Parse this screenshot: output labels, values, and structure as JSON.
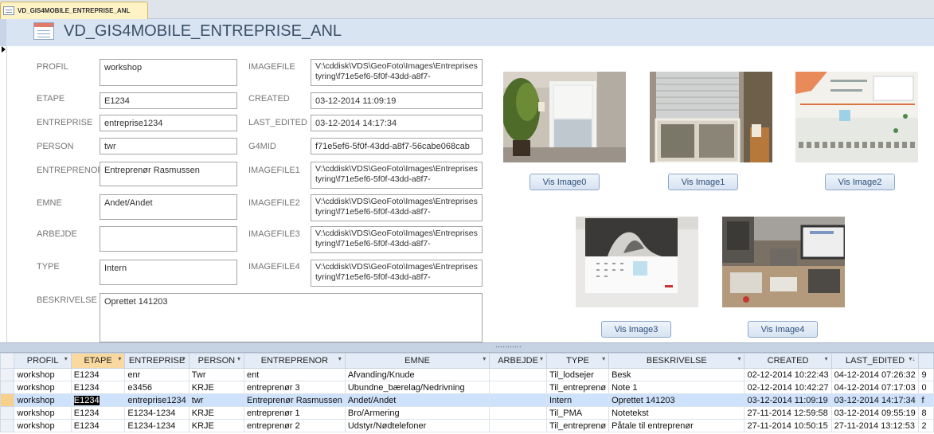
{
  "tab": {
    "label": "VD_GIS4MOBILE_ENTREPRISE_ANL"
  },
  "form": {
    "title": "VD_GIS4MOBILE_ENTREPRISE_ANL",
    "fields": {
      "profil": {
        "label": "PROFIL",
        "value": "workshop"
      },
      "etape": {
        "label": "ETAPE",
        "value": "E1234"
      },
      "entreprise": {
        "label": "ENTREPRISE",
        "value": "entreprise1234"
      },
      "person": {
        "label": "PERSON",
        "value": "twr"
      },
      "entreprenor": {
        "label": "ENTREPRENOR",
        "value": "Entreprenør Rasmussen"
      },
      "emne": {
        "label": "EMNE",
        "value": "Andet/Andet"
      },
      "arbejde": {
        "label": "ARBEJDE",
        "value": ""
      },
      "type": {
        "label": "TYPE",
        "value": "Intern"
      },
      "beskrivelse": {
        "label": "BESKRIVELSE",
        "value": "Oprettet 141203"
      },
      "imagefile": {
        "label": "IMAGEFILE",
        "value": "V:\\cddisk\\VDS\\GeoFoto\\Images\\Entreprisestyring\\f71e5ef6-5f0f-43dd-a8f7-"
      },
      "created": {
        "label": "CREATED",
        "value": "03-12-2014 11:09:19"
      },
      "last_edited": {
        "label": "LAST_EDITED",
        "value": "03-12-2014 14:17:34"
      },
      "g4mid": {
        "label": "G4MID",
        "value": "f71e5ef6-5f0f-43dd-a8f7-56cabe068cab"
      },
      "imagefile1": {
        "label": "IMAGEFILE1",
        "value": "V:\\cddisk\\VDS\\GeoFoto\\Images\\Entreprisestyring\\f71e5ef6-5f0f-43dd-a8f7-"
      },
      "imagefile2": {
        "label": "IMAGEFILE2",
        "value": "V:\\cddisk\\VDS\\GeoFoto\\Images\\Entreprisestyring\\f71e5ef6-5f0f-43dd-a8f7-"
      },
      "imagefile3": {
        "label": "IMAGEFILE3",
        "value": "V:\\cddisk\\VDS\\GeoFoto\\Images\\Entreprisestyring\\f71e5ef6-5f0f-43dd-a8f7-"
      },
      "imagefile4": {
        "label": "IMAGEFILE4",
        "value": "V:\\cddisk\\VDS\\GeoFoto\\Images\\Entreprisestyring\\f71e5ef6-5f0f-43dd-a8f7-"
      }
    },
    "buttons": {
      "vis_image0": "Vis Image0",
      "vis_image1": "Vis Image1",
      "vis_image2": "Vis Image2",
      "vis_image3": "Vis Image3",
      "vis_image4": "Vis Image4"
    }
  },
  "datasheet": {
    "columns": [
      "PROFIL",
      "ETAPE",
      "ENTREPRISE",
      "PERSON",
      "ENTREPRENOR",
      "EMNE",
      "ARBEJDE",
      "TYPE",
      "BESKRIVELSE",
      "CREATED",
      "LAST_EDITED"
    ],
    "rows": [
      [
        "workshop",
        "E1234",
        "enr",
        "Twr",
        "ent",
        "Afvanding/Knude",
        "",
        "Til_lodsejer",
        "Besk",
        "02-12-2014 10:22:43",
        "04-12-2014 07:26:32"
      ],
      [
        "workshop",
        "E1234",
        "e3456",
        "KRJE",
        "entreprenør 3",
        "Ubundne_bærelag/Nedrivning",
        "",
        "Til_entreprenø",
        "Note 1",
        "02-12-2014 10:42:27",
        "04-12-2014 07:17:03"
      ],
      [
        "workshop",
        "E1234",
        "entreprise1234",
        "twr",
        "Entreprenør Rasmussen",
        "Andet/Andet",
        "",
        "Intern",
        "Oprettet 141203",
        "03-12-2014 11:09:19",
        "03-12-2014 14:17:34"
      ],
      [
        "workshop",
        "E1234",
        "E1234-1234",
        "KRJE",
        "entreprenør 1",
        "Bro/Armering",
        "",
        "Til_PMA",
        "Notetekst",
        "27-11-2014 12:59:58",
        "03-12-2014 09:55:19"
      ],
      [
        "workshop",
        "E1234",
        "E1234-1234",
        "KRJE",
        "entreprenør 2",
        "Udstyr/Nødtelefoner",
        "",
        "Til_entreprenø",
        "Påtale til entreprenør",
        "27-11-2014 10:50:15",
        "27-11-2014 13:12:53"
      ]
    ],
    "overflow_col": [
      "9",
      "0",
      "f",
      "8",
      "2"
    ],
    "current_row": 2,
    "sort_indicator": "▾↓"
  },
  "colors": {
    "header_bg": "#d9e4f3",
    "selected_row": "#cfe2fb",
    "selected_header": "#f9d9a0",
    "accent": "#3b4e66"
  },
  "icons": [
    "form-icon",
    "record-arrow-icon",
    "dropdown-arrow-icon"
  ]
}
